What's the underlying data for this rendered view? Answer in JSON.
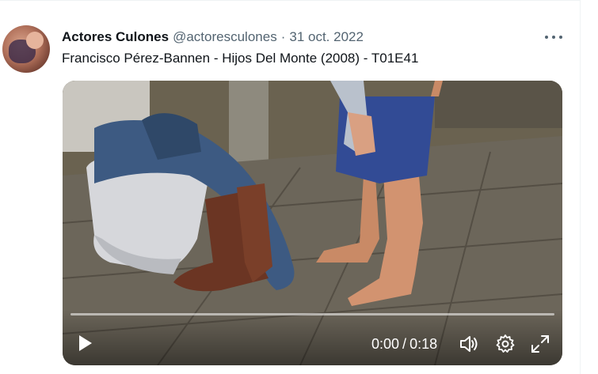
{
  "tweet": {
    "display_name": "Actores Culones",
    "handle": "@actoresculones",
    "separator": "·",
    "date": "31 oct. 2022",
    "text": "Francisco Pérez-Bannen - Hijos Del Monte (2008) - T01E41"
  },
  "video": {
    "current_time": "0:00",
    "time_separator": "/",
    "duration": "0:18",
    "progress_fraction": 0.0
  },
  "icons": {
    "more": "more-horizontal-icon",
    "play": "play-icon",
    "volume": "volume-icon",
    "settings": "gear-icon",
    "fullscreen": "fullscreen-icon"
  },
  "colors": {
    "text_primary": "#0f1419",
    "text_secondary": "#536471",
    "control_white": "#ffffff"
  }
}
